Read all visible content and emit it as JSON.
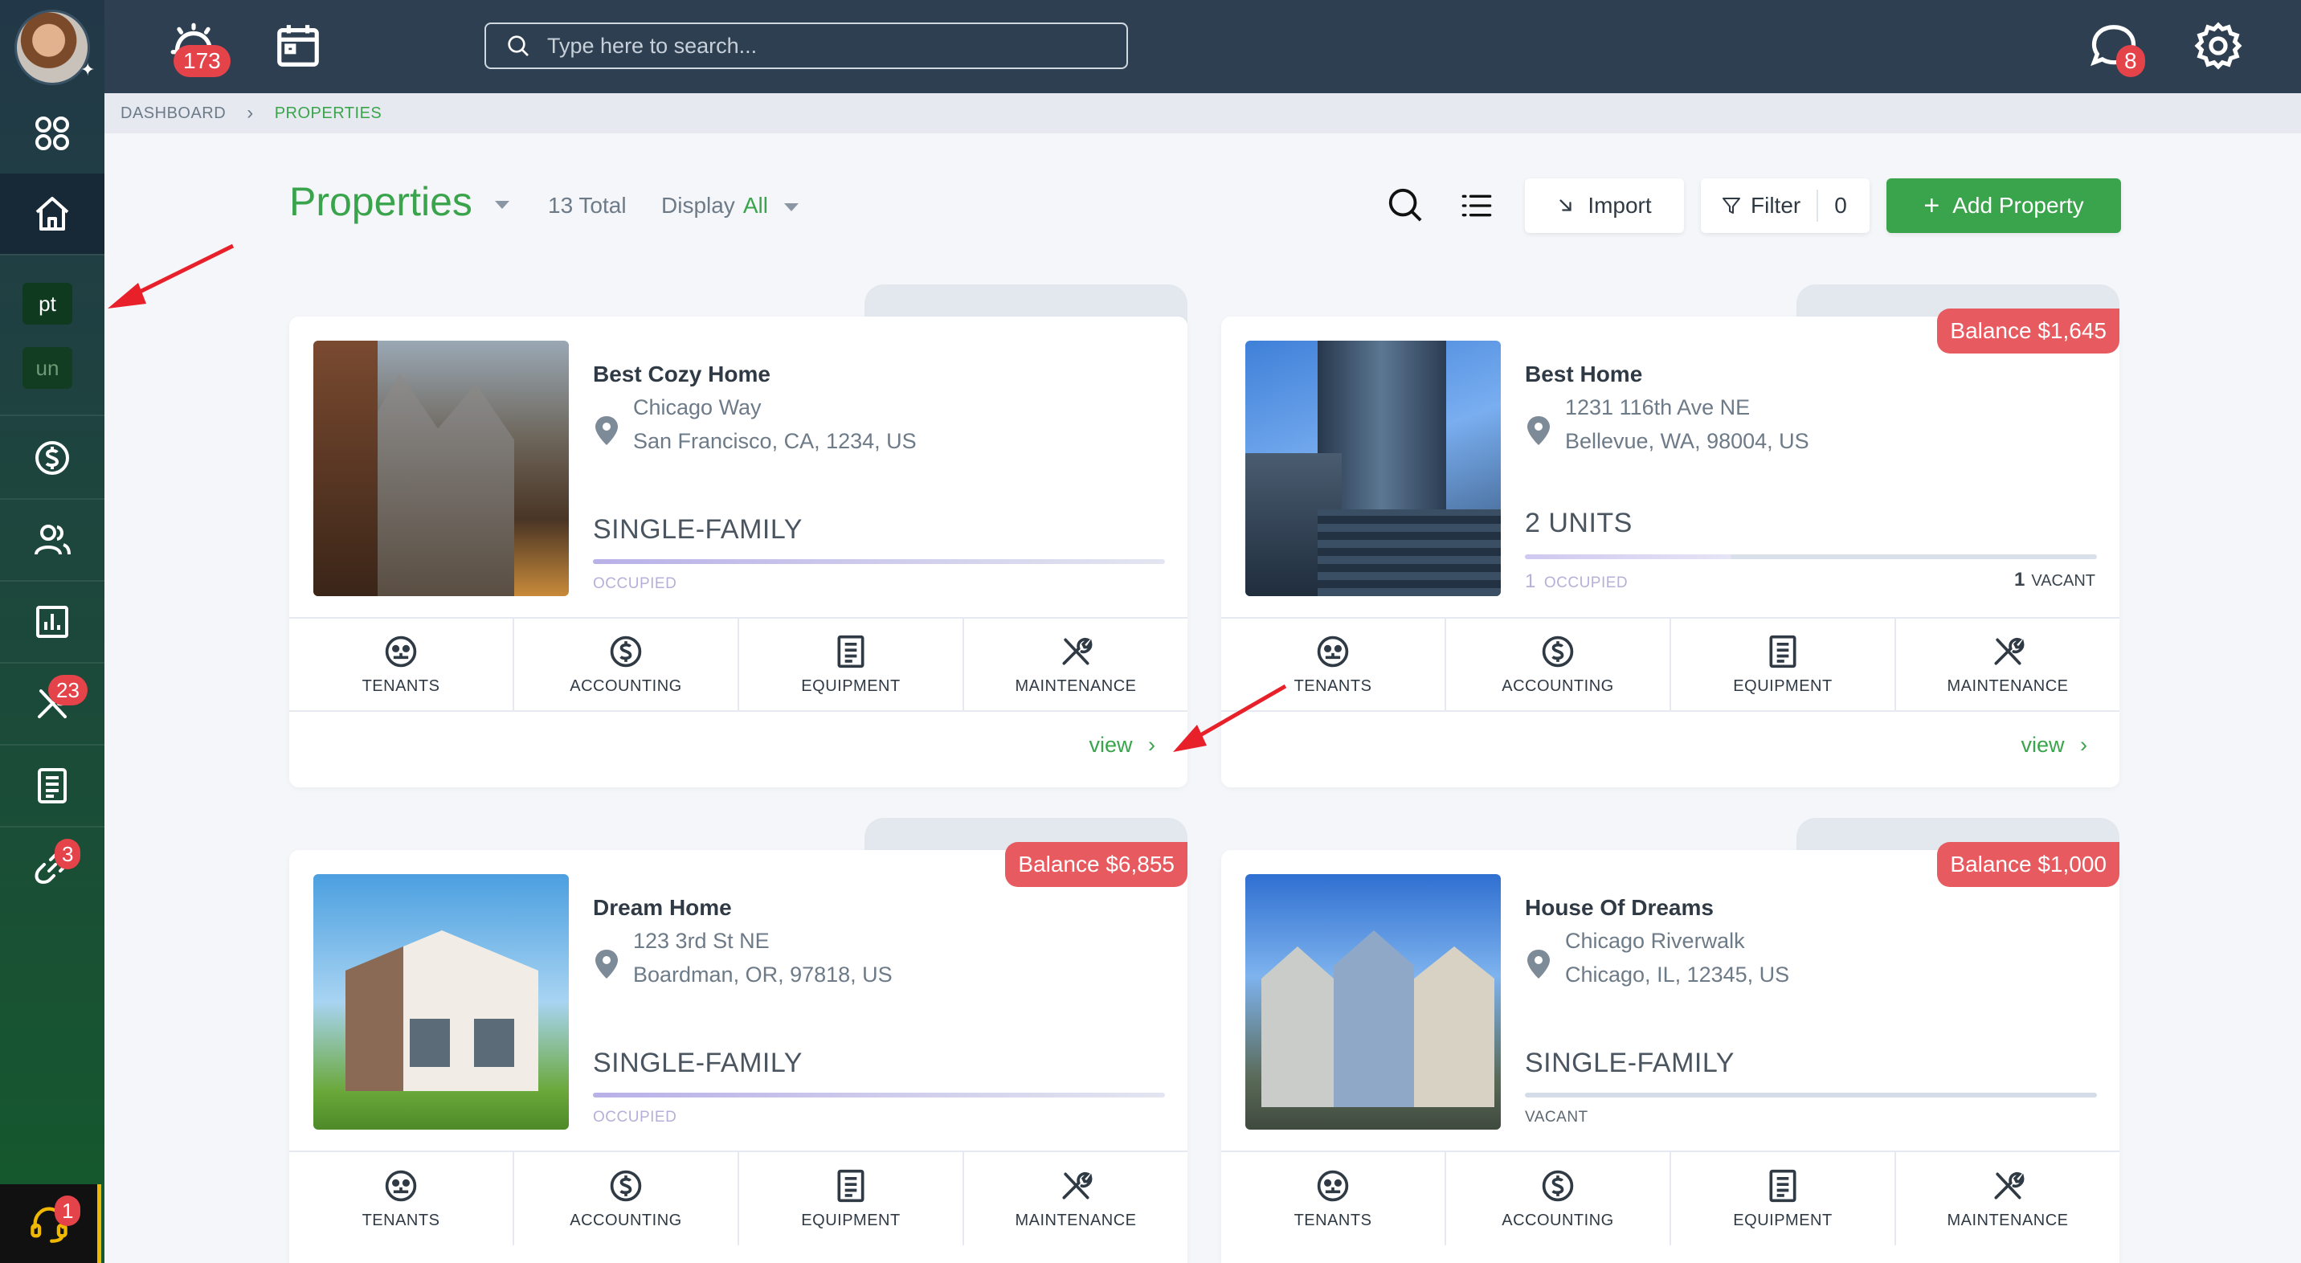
{
  "topbar": {
    "alerts_count": "173",
    "search_placeholder": "Type here to search...",
    "messages_count": "8"
  },
  "sidebar": {
    "chip_pt": "pt",
    "chip_un": "un",
    "maintenance_count": "23",
    "links_count": "3",
    "support_count": "1"
  },
  "breadcrumb": {
    "home": "DASHBOARD",
    "current": "PROPERTIES"
  },
  "header": {
    "title": "Properties",
    "total": "13 Total",
    "display_label": "Display",
    "display_value": "All",
    "import_label": "Import",
    "filter_label": "Filter",
    "filter_count": "0",
    "add_label": "Add Property"
  },
  "action_labels": {
    "tenants": "TENANTS",
    "accounting": "ACCOUNTING",
    "equipment": "EQUIPMENT",
    "maintenance": "MAINTENANCE"
  },
  "cards": [
    {
      "name": "Best Cozy Home",
      "address1": "Chicago Way",
      "address2": "San Francisco, CA, 1234, US",
      "type": "SINGLE-FAMILY",
      "status": "OCCUPIED",
      "view": "view"
    },
    {
      "name": "Best Home",
      "balance": "Balance $1,645",
      "address1": "1231 116th Ave NE",
      "address2": "Bellevue, WA, 98004, US",
      "type": "2 UNITS",
      "occupied_count": "1",
      "status": "OCCUPIED",
      "vacant_count": "1",
      "vacant_label": "VACANT",
      "view": "view"
    },
    {
      "name": "Dream Home",
      "balance": "Balance $6,855",
      "address1": "123 3rd St NE",
      "address2": "Boardman, OR, 97818, US",
      "type": "SINGLE-FAMILY",
      "status": "OCCUPIED"
    },
    {
      "name": "House Of Dreams",
      "balance": "Balance $1,000",
      "address1": "Chicago Riverwalk",
      "address2": "Chicago, IL, 12345, US",
      "type": "SINGLE-FAMILY",
      "status": "VACANT"
    }
  ],
  "colors": {
    "accent": "#3aa44c",
    "topbar": "#2e3f52",
    "balance": "#e75a5f",
    "badge": "#e4434a",
    "annotation_arrow": "#e8202a"
  }
}
